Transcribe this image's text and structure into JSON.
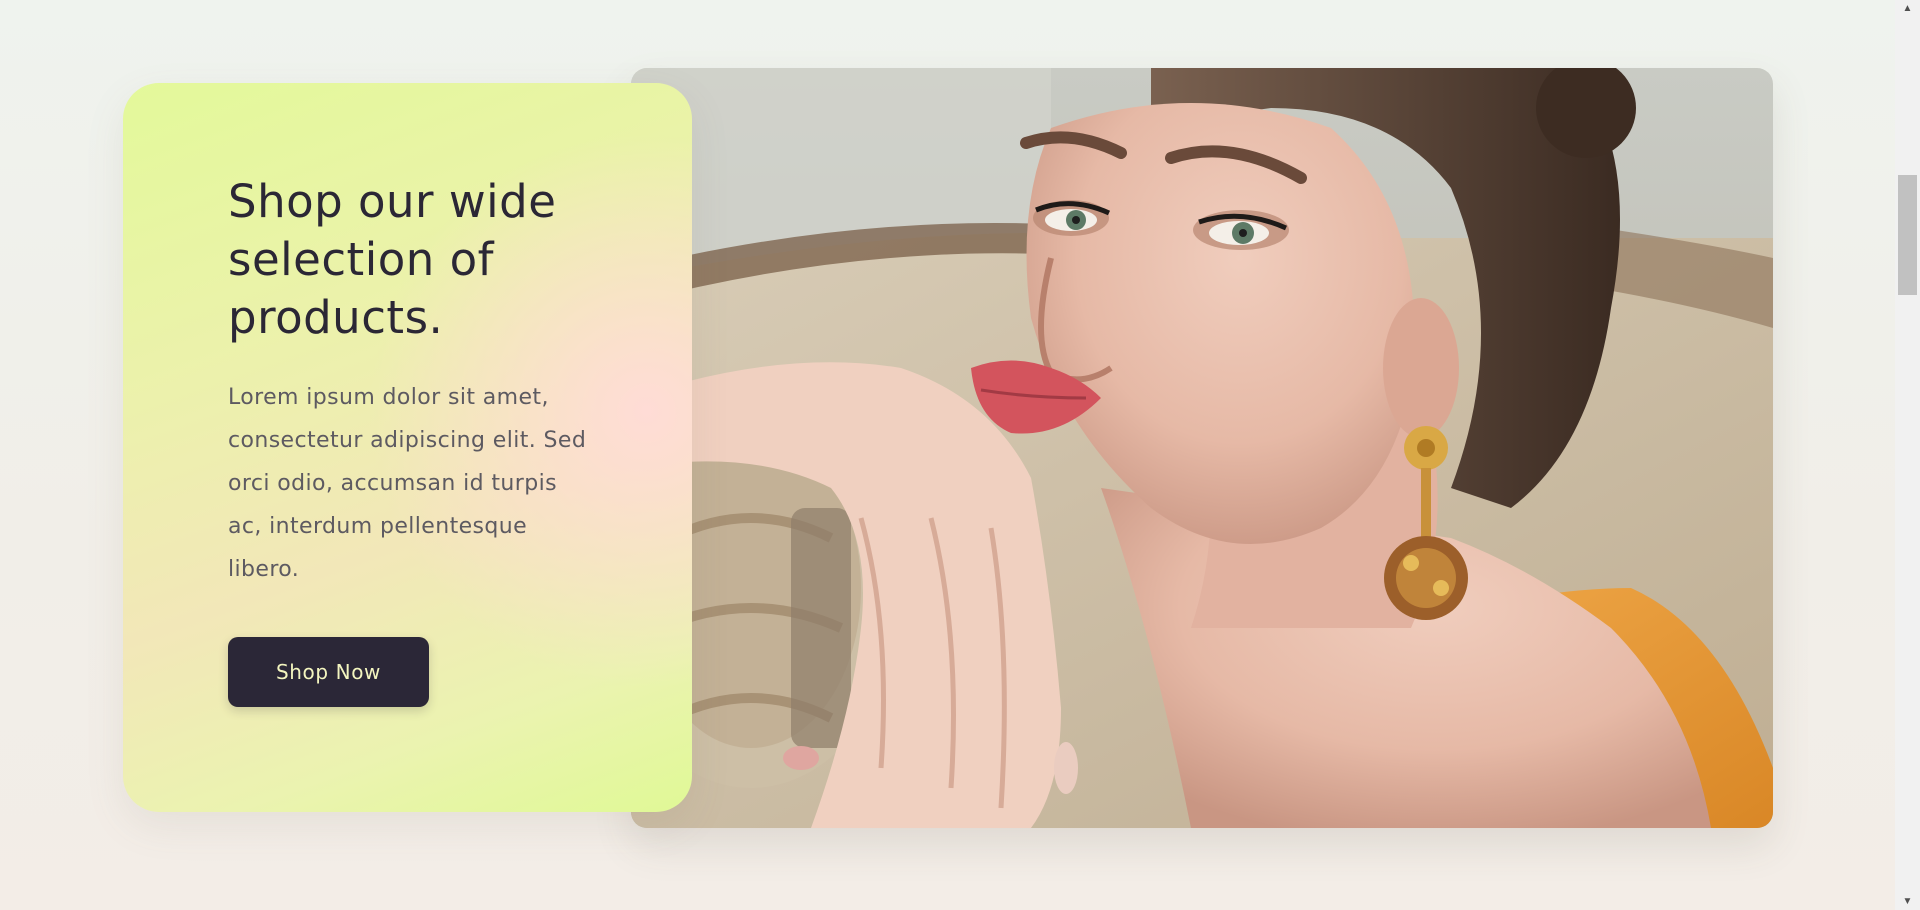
{
  "hero": {
    "heading": "Shop our wide selection of products.",
    "body": "Lorem ipsum dolor sit amet, consectetur adipiscing elit. Sed orci odio, accumsan id turpis ac, interdum pellentesque libero.",
    "button_label": "Shop Now",
    "image_icon": "portrait-photo"
  },
  "colors": {
    "button_bg": "#2b2737",
    "button_text": "#f3f5bf",
    "heading": "#2b2735",
    "body_text": "#5d5a61",
    "card_gradient_start": "#e3f99a",
    "card_gradient_accent": "#ffdcd6",
    "page_bg": "#f0efe9"
  },
  "scrollbar": {
    "up_icon": "scroll-up-arrow-icon",
    "down_icon": "scroll-down-arrow-icon"
  }
}
